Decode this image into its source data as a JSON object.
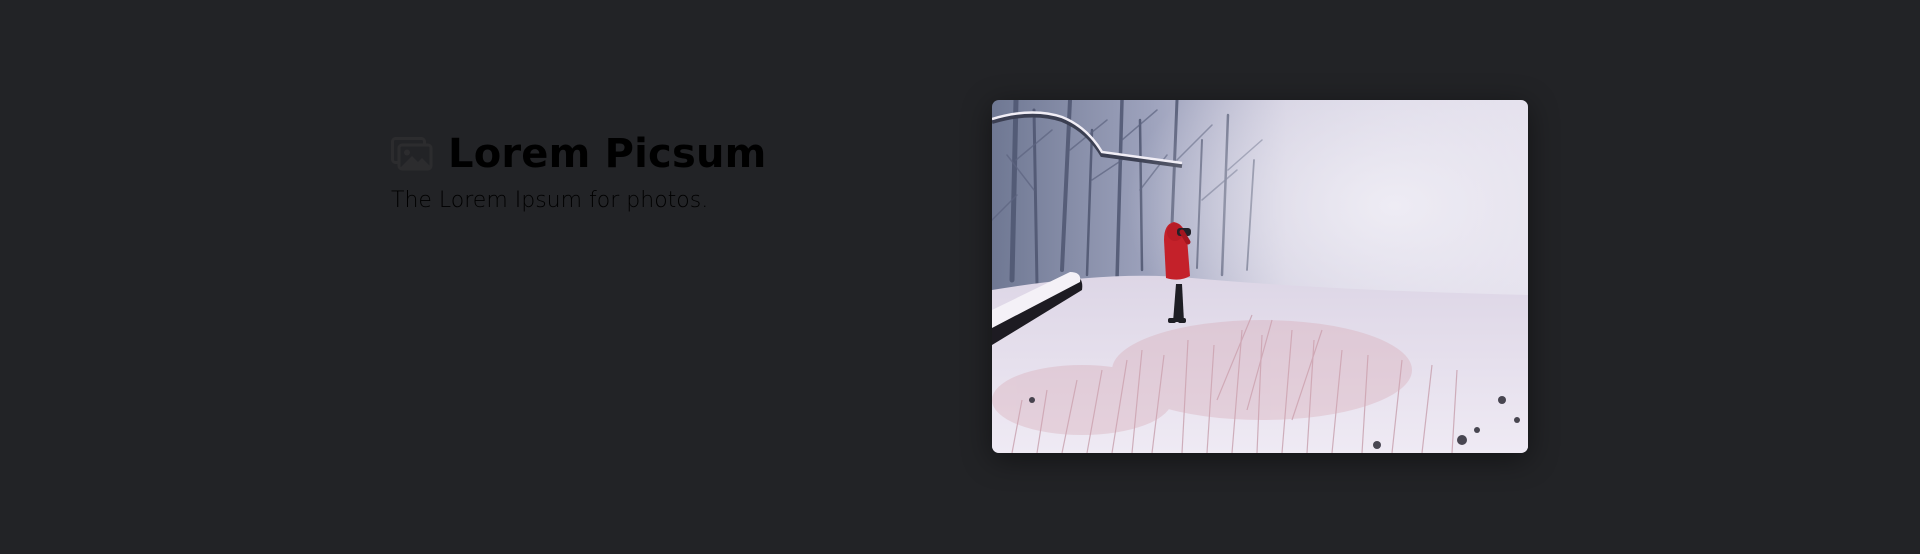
{
  "brand": {
    "title": "Lorem Picsum",
    "tagline": "The Lorem Ipsum for photos.",
    "logo_icon": "photos-icon"
  },
  "hero_image": {
    "description_icon": "snowy-photo",
    "colors": {
      "background": "#222326",
      "jacket": "#c4212a",
      "snow": "#ece8f2"
    }
  }
}
